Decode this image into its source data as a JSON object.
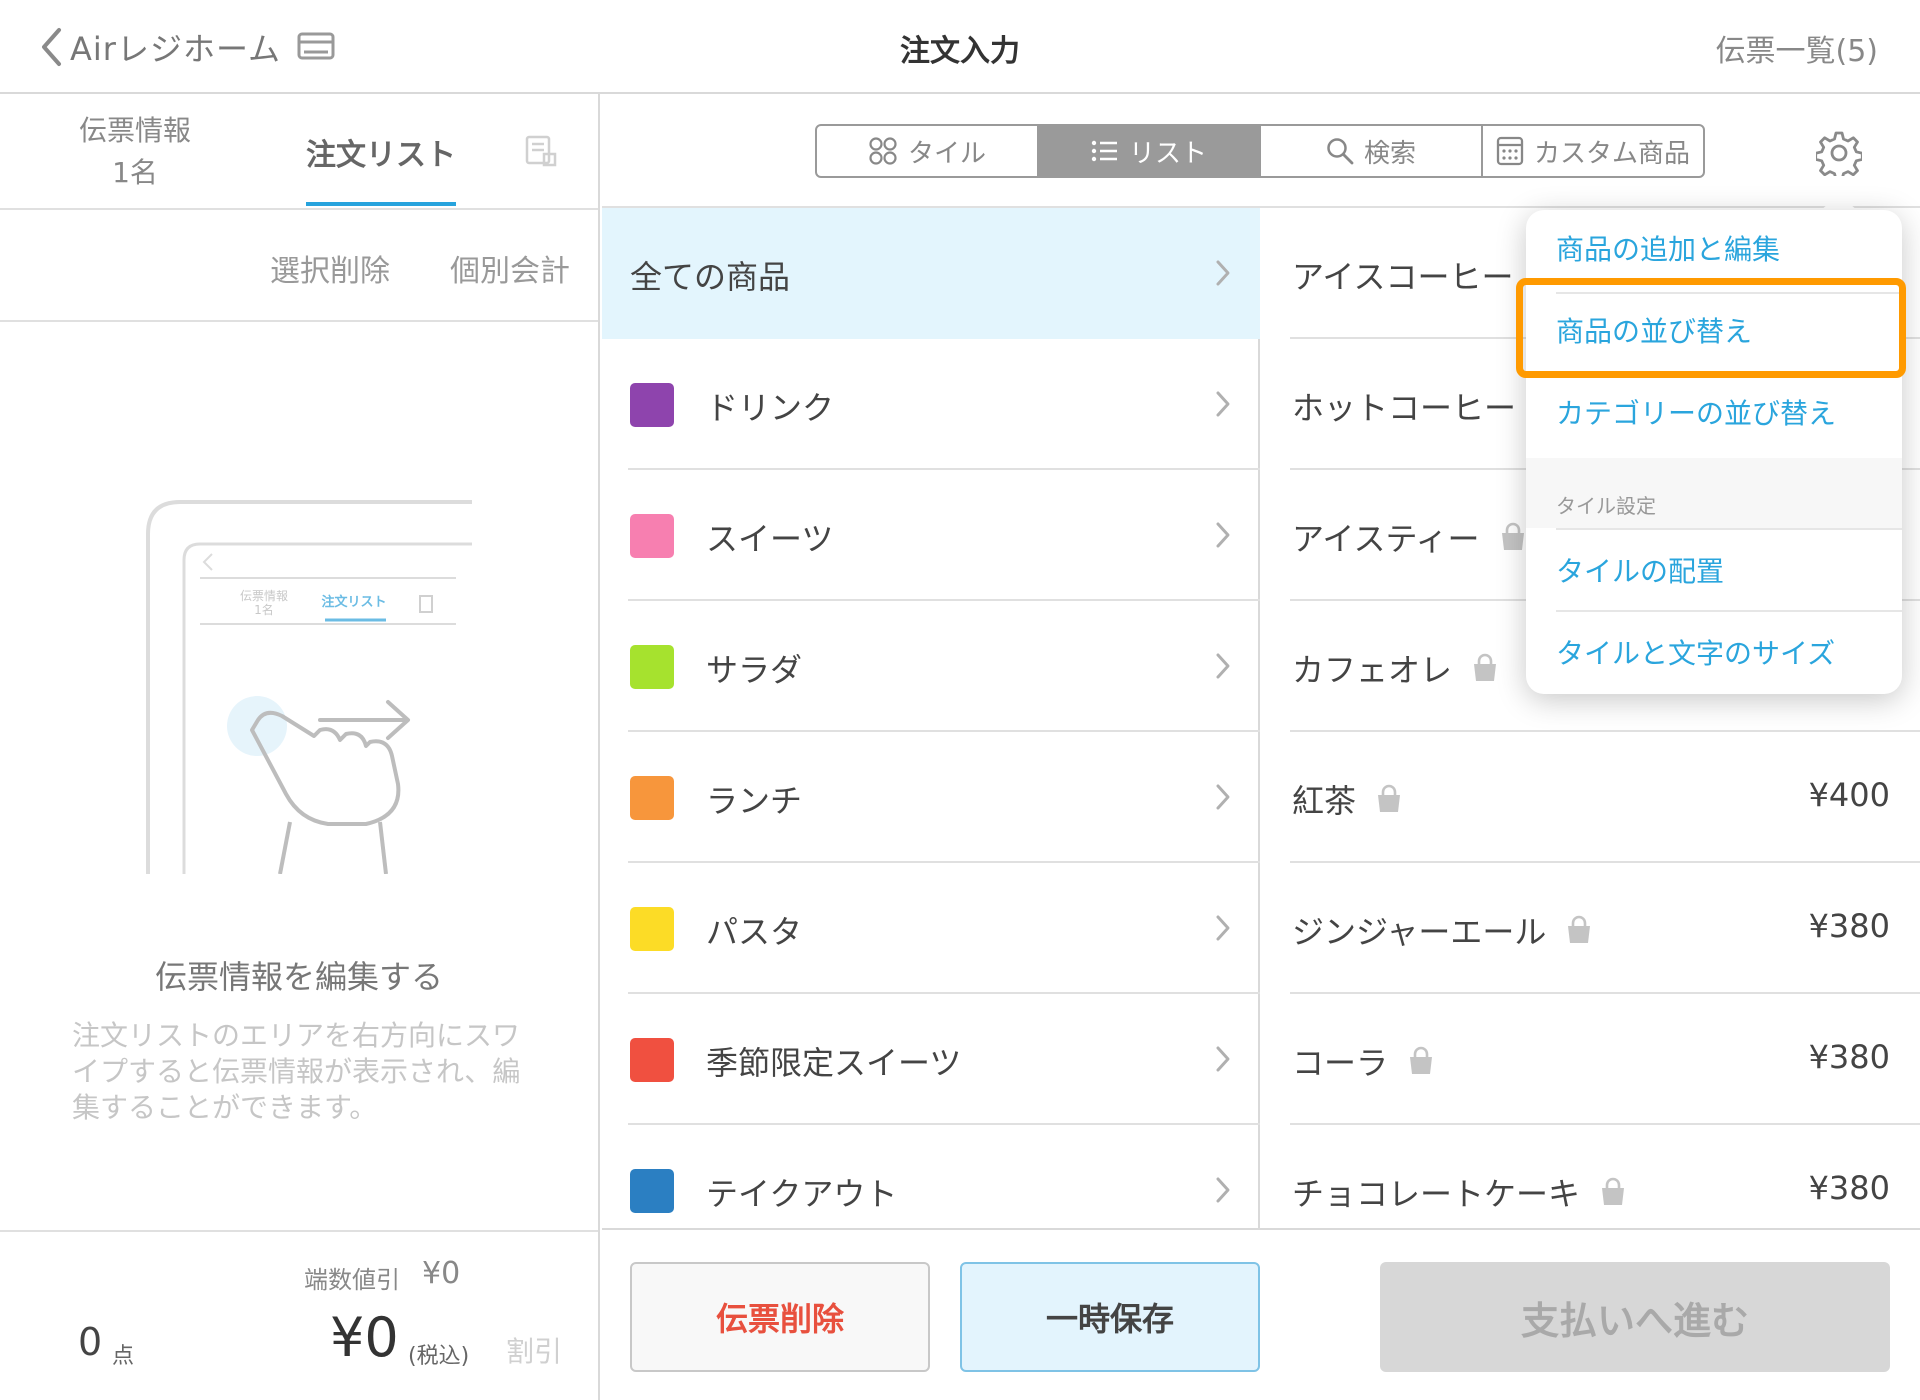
{
  "header": {
    "back_label": "Airレジホーム",
    "title": "注文入力",
    "slips_link": "伝票一覧(5)"
  },
  "left_panel": {
    "tab_info_line1": "伝票情報",
    "tab_info_line2": "1名",
    "tab_order": "注文リスト",
    "action_select_delete": "選択削除",
    "action_split_bill": "個別会計",
    "illustration": {
      "tab_info_line1": "伝票情報",
      "tab_info_line2": "1名",
      "tab_order": "注文リスト"
    },
    "hint_title": "伝票情報を編集する",
    "hint_body": "注文リストのエリアを右方向にスワイプすると伝票情報が表示され、編集することができます。",
    "rounding_label": "端数値引",
    "rounding_value": "¥0",
    "count_value": "0",
    "count_unit": "点",
    "total_value": "¥0",
    "total_tax_note": "(税込)",
    "discount_label": "割引"
  },
  "toolbar": {
    "tabs": [
      {
        "label": "タイル",
        "icon": "grid-icon",
        "active": false
      },
      {
        "label": "リスト",
        "icon": "list-icon",
        "active": true
      },
      {
        "label": "検索",
        "icon": "search-icon",
        "active": false
      },
      {
        "label": "カスタム商品",
        "icon": "calculator-icon",
        "active": false
      }
    ],
    "settings_icon": "gear-icon"
  },
  "categories": [
    {
      "name": "全ての商品",
      "color": null,
      "selected": true
    },
    {
      "name": "ドリンク",
      "color": "#8e44ad",
      "selected": false
    },
    {
      "name": "スイーツ",
      "color": "#f77fb0",
      "selected": false
    },
    {
      "name": "サラダ",
      "color": "#a6e22e",
      "selected": false
    },
    {
      "name": "ランチ",
      "color": "#f7963c",
      "selected": false
    },
    {
      "name": "パスタ",
      "color": "#fcdc26",
      "selected": false
    },
    {
      "name": "季節限定スイーツ",
      "color": "#f05040",
      "selected": false
    },
    {
      "name": "テイクアウト",
      "color": "#2b7fc2",
      "selected": false
    }
  ],
  "products": [
    {
      "name": "アイスコーヒー",
      "bag": false,
      "price": ""
    },
    {
      "name": "ホットコーヒー",
      "bag": false,
      "price": ""
    },
    {
      "name": "アイスティー",
      "bag": true,
      "price": ""
    },
    {
      "name": "カフェオレ",
      "bag": true,
      "price": ""
    },
    {
      "name": "紅茶",
      "bag": true,
      "price": "¥400"
    },
    {
      "name": "ジンジャーエール",
      "bag": true,
      "price": "¥380"
    },
    {
      "name": "コーラ",
      "bag": true,
      "price": "¥380"
    },
    {
      "name": "チョコレートケーキ",
      "bag": true,
      "price": "¥380"
    }
  ],
  "bottom": {
    "delete_slip": "伝票削除",
    "hold": "一時保存",
    "proceed_payment": "支払いへ進む"
  },
  "popover": {
    "add_edit": "商品の追加と編集",
    "sort_products": "商品の並び替え",
    "sort_categories": "カテゴリーの並び替え",
    "tile_settings_header": "タイル設定",
    "tile_layout": "タイルの配置",
    "tile_text_size": "タイルと文字のサイズ",
    "highlighted_item": "商品の並び替え"
  },
  "colors": {
    "accent": "#27a3dd",
    "highlight": "#ff9a00",
    "danger": "#e8503e",
    "selected_bg": "#e3f5fd"
  }
}
